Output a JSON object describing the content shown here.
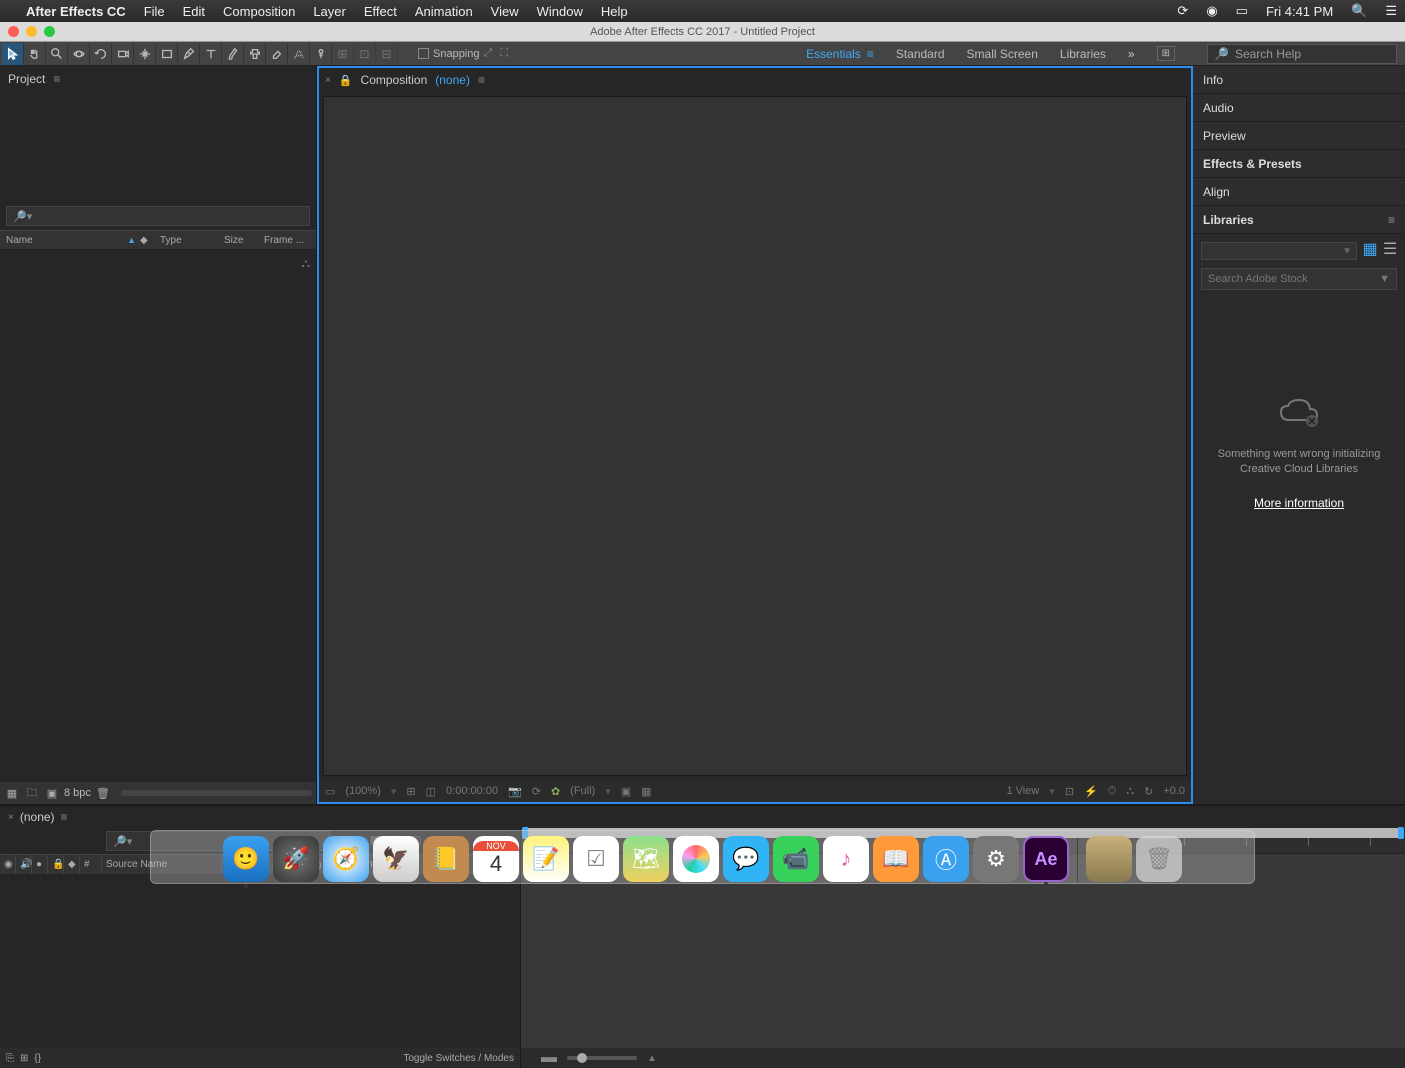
{
  "macmenu": {
    "app": "After Effects CC",
    "items": [
      "File",
      "Edit",
      "Composition",
      "Layer",
      "Effect",
      "Animation",
      "View",
      "Window",
      "Help"
    ],
    "clock": "Fri 4:41 PM"
  },
  "window": {
    "title": "Adobe After Effects CC 2017 - Untitled Project"
  },
  "toolbar": {
    "snapping_label": "Snapping",
    "workspaces": [
      "Essentials",
      "Standard",
      "Small Screen",
      "Libraries"
    ],
    "search_placeholder": "Search Help"
  },
  "project": {
    "tab": "Project",
    "cols": {
      "name": "Name",
      "type": "Type",
      "size": "Size",
      "frame": "Frame ..."
    },
    "bpc": "8 bpc"
  },
  "comp": {
    "tab_prefix": "Composition",
    "tab_none": "(none)",
    "footer": {
      "zoom": "(100%)",
      "time": "0:00:00:00",
      "res": "(Full)",
      "view": "1 View",
      "exposure": "+0.0"
    }
  },
  "right": {
    "panels": [
      "Info",
      "Audio",
      "Preview",
      "Effects & Presets",
      "Align",
      "Libraries"
    ],
    "lib_search": "Search Adobe Stock",
    "lib_error_l1": "Something went wrong initializing",
    "lib_error_l2": "Creative Cloud Libraries",
    "lib_link": "More information"
  },
  "timeline": {
    "tab": "(none)",
    "cols": {
      "num": "#",
      "source": "Source Name",
      "parent": "Parent"
    },
    "toggle": "Toggle Switches / Modes"
  },
  "dock": {
    "cal_month": "NOV",
    "cal_day": "4",
    "ae": "Ae"
  }
}
